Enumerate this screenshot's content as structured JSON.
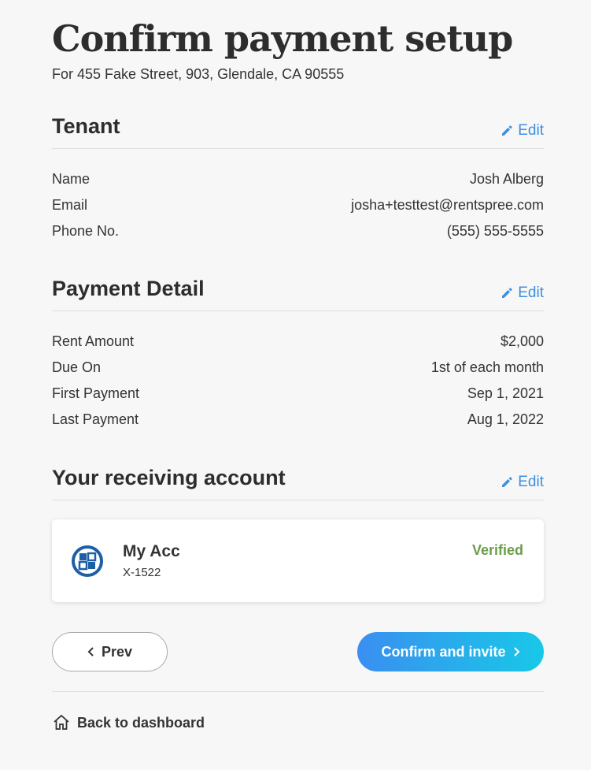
{
  "header": {
    "title": "Confirm payment setup",
    "subtitle": "For 455 Fake Street, 903, Glendale, CA 90555"
  },
  "tenant": {
    "title": "Tenant",
    "edit_label": "Edit",
    "rows": [
      {
        "label": "Name",
        "value": "Josh Alberg"
      },
      {
        "label": "Email",
        "value": "josha+testtest@rentspree.com"
      },
      {
        "label": "Phone No.",
        "value": "(555) 555-5555"
      }
    ]
  },
  "payment": {
    "title": "Payment Detail",
    "edit_label": "Edit",
    "rows": [
      {
        "label": "Rent Amount",
        "value": "$2,000"
      },
      {
        "label": "Due On",
        "value": "1st of each month"
      },
      {
        "label": "First Payment",
        "value": "Sep 1, 2021"
      },
      {
        "label": "Last Payment",
        "value": "Aug 1, 2022"
      }
    ]
  },
  "account": {
    "title": "Your receiving account",
    "edit_label": "Edit",
    "name": "My Acc",
    "number": "X-1522",
    "status": "Verified",
    "bank_icon": "bank-logo-icon"
  },
  "actions": {
    "prev_label": "Prev",
    "confirm_label": "Confirm and invite",
    "back_label": "Back to dashboard"
  },
  "colors": {
    "accent": "#3d8fe0",
    "verified": "#6a9e4a",
    "gradient_start": "#3a8ff0",
    "gradient_end": "#18c8e8"
  }
}
